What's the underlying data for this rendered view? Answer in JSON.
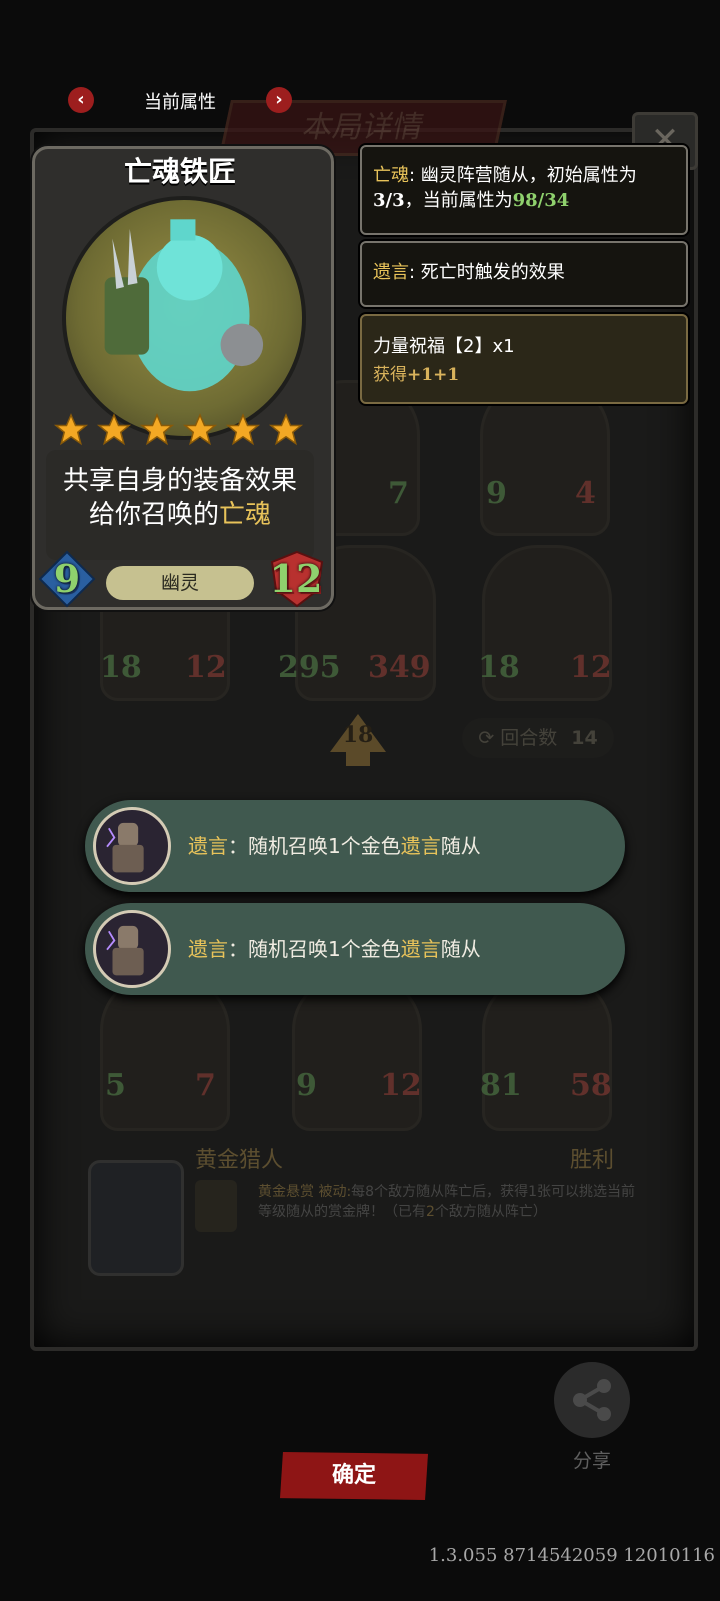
{
  "background": {
    "board_title": "本局详情",
    "close_glyph": "✕",
    "round_label": "回合数",
    "round_value": "14",
    "upgrade_level": "18",
    "cards": [
      {
        "atk": "7"
      },
      {
        "atk": "9",
        "hp": "4"
      },
      {
        "atk": "18",
        "hp": "12"
      },
      {
        "atk": "295",
        "hp": "349"
      },
      {
        "atk": "18",
        "hp": "12"
      },
      {
        "atk": "5",
        "hp": "7"
      },
      {
        "atk": "9",
        "hp": "12"
      },
      {
        "atk": "81",
        "hp": "58"
      }
    ],
    "hero": {
      "name": "黄金猎人",
      "result": "胜利",
      "desc_prefix": "黄金悬赏 被动:",
      "desc_body": "每8个敌方随从阵亡后，获得1张可以挑选当前等级随从的赏金牌！（已有",
      "desc_count": "2",
      "desc_suffix": "个敌方随从阵亡）"
    }
  },
  "nav": {
    "title": "当前属性",
    "prev_glyph": "‹",
    "next_glyph": "›"
  },
  "card": {
    "name": "亡魂铁匠",
    "stars": 6,
    "text_prefix": "共享自身的装备效果给你召唤的",
    "text_highlight": "亡魂",
    "tribe": "幽灵",
    "atk": "9",
    "hp": "12"
  },
  "panels": {
    "tribe_info": {
      "keyword": "亡魂",
      "text1": ": 幽灵阵营随从，初始属性为",
      "base": "3/3",
      "text2": "，当前属性为",
      "current": "98/34"
    },
    "deathrattle_info": {
      "keyword": "遗言",
      "text": ": 死亡时触发的效果"
    },
    "buff": {
      "title": "力量祝福【2】x1",
      "gain_label": "获得",
      "gain_value": "+1+1"
    }
  },
  "toasts": [
    {
      "keyword": "遗言",
      "before": "：随机召唤1个金色",
      "keyword2": "遗言",
      "after": "随从"
    },
    {
      "keyword": "遗言",
      "before": "：随机召唤1个金色",
      "keyword2": "遗言",
      "after": "随从"
    }
  ],
  "share": {
    "label": "分享"
  },
  "confirm": {
    "label": "确定"
  },
  "version": "1.3.055 8714542059 12010116",
  "colors": {
    "keyword": "#e8c35a",
    "positive": "#8fd16d",
    "confirm_bg": "#8e1515",
    "toast_bg": "#40594f"
  }
}
